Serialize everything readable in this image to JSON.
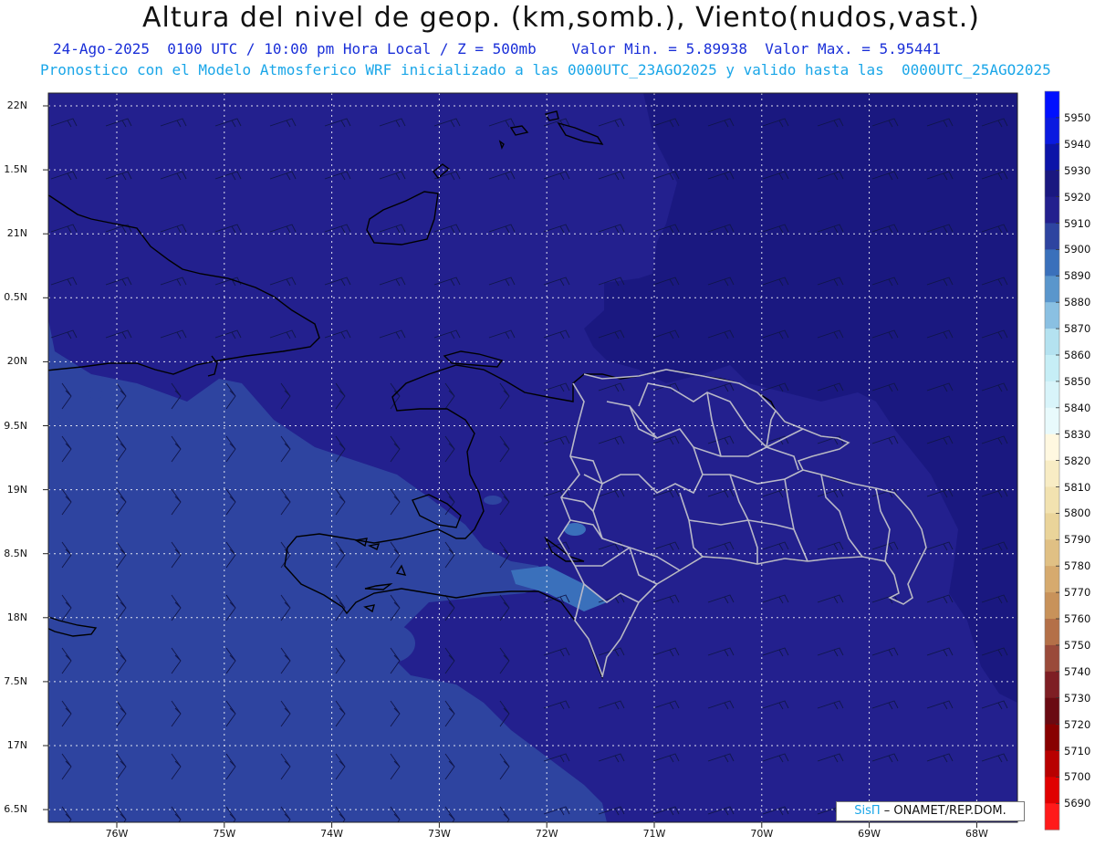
{
  "header": {
    "title": "Altura del nivel de geop. (km,somb.), Viento(nudos,vast.)",
    "subtitle1": "24-Ago-2025  0100 UTC / 10:00 pm Hora Local / Z = 500mb    Valor Min. = 5.89938  Valor Max. = 5.95441",
    "subtitle2": "Pronostico con el Modelo Atmosferico WRF inicializado a las 0000UTC_23AGO2025 y valido hasta las  0000UTC_25AGO2025"
  },
  "map": {
    "lat_labels": [
      "22N",
      "1.5N",
      "21N",
      "0.5N",
      "20N",
      "9.5N",
      "19N",
      "8.5N",
      "18N",
      "7.5N",
      "17N",
      "6.5N"
    ],
    "lon_labels": [
      "76W",
      "75W",
      "74W",
      "73W",
      "72W",
      "71W",
      "70W",
      "69W",
      "68W"
    ]
  },
  "colorbar": {
    "levels": [
      "5950",
      "5940",
      "5930",
      "5920",
      "5910",
      "5900",
      "5890",
      "5880",
      "5870",
      "5860",
      "5850",
      "5840",
      "5830",
      "5820",
      "5810",
      "5800",
      "5790",
      "5780",
      "5770",
      "5760",
      "5750",
      "5740",
      "5730",
      "5720",
      "5710",
      "5700",
      "5690"
    ],
    "colors": [
      "#0010ff",
      "#0a1ae0",
      "#0c14a8",
      "#1a1880",
      "#23208e",
      "#2e44a0",
      "#3a70bb",
      "#5a96cc",
      "#8ac0e2",
      "#b4e2f0",
      "#c6eef6",
      "#d8f4fa",
      "#e8fafc",
      "#fff8e0",
      "#f8ecc4",
      "#f2e2b0",
      "#ead49a",
      "#e0c084",
      "#d6aa6e",
      "#c8925a",
      "#b47048",
      "#9a4a3a",
      "#7e1e24",
      "#6a0a12",
      "#880000",
      "#b80000",
      "#e00000",
      "#ff1a1a"
    ]
  },
  "credit": {
    "sis": "SisΠ",
    "org": "– ONAMET/REP.DOM."
  }
}
